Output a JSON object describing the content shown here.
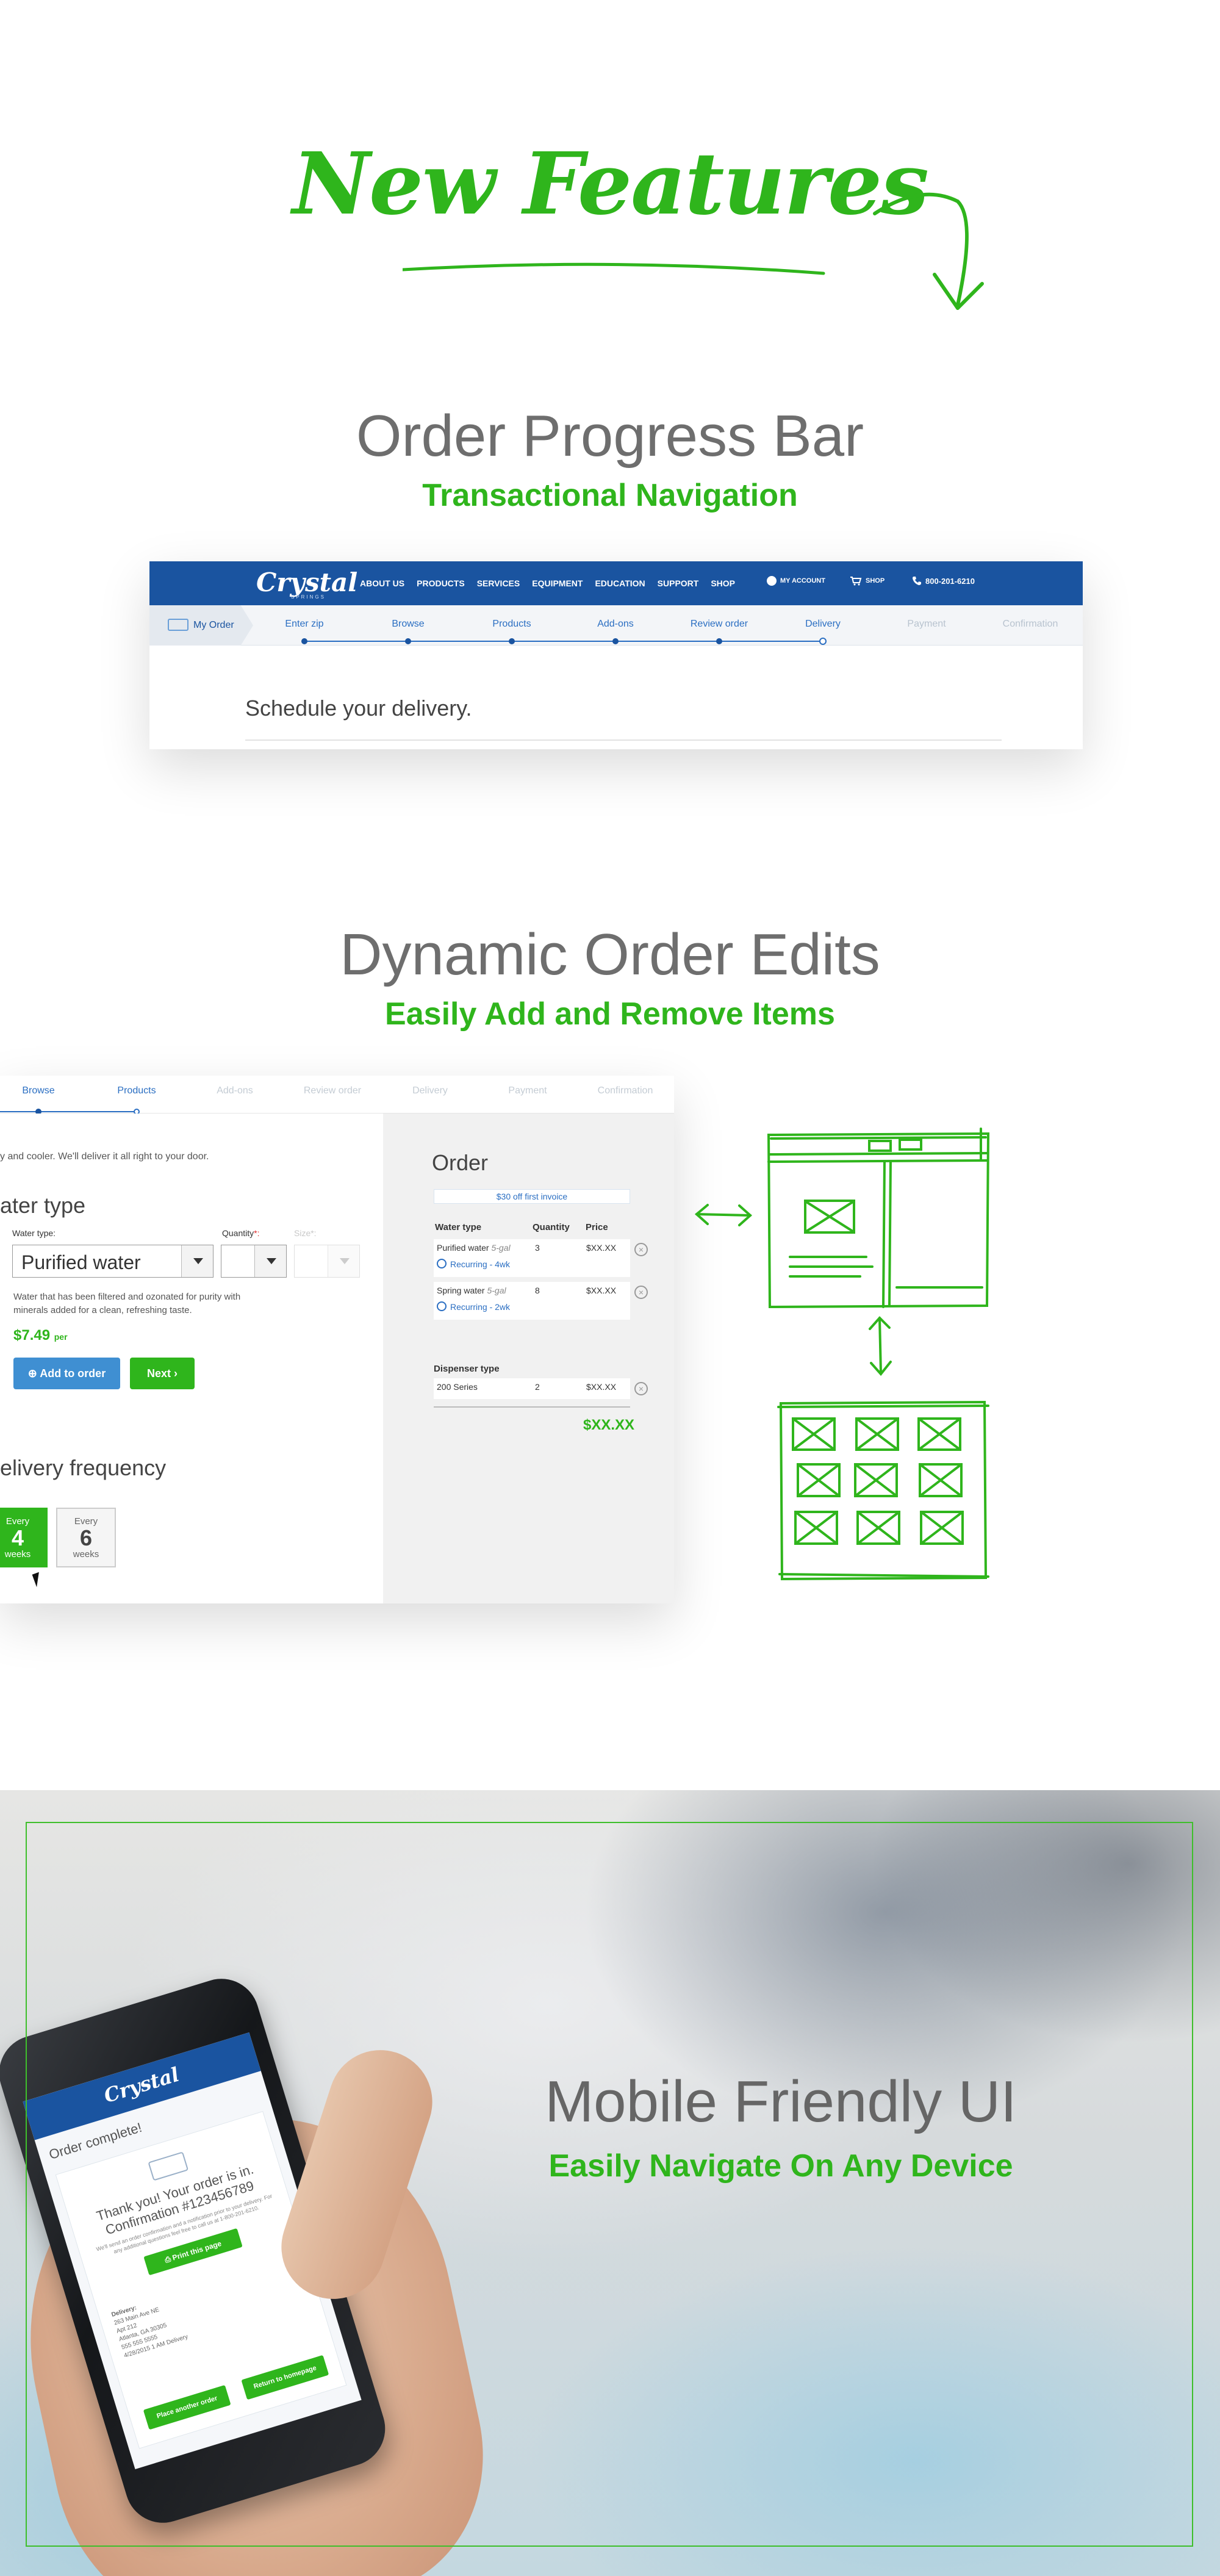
{
  "hero": {
    "title": "New Features"
  },
  "section1": {
    "title": "Order Progress Bar",
    "subtitle": "Transactional Navigation",
    "brand": {
      "logo": "Crystal",
      "tagline": "SPRINGS"
    },
    "nav": [
      "ABOUT US",
      "PRODUCTS",
      "SERVICES",
      "EQUIPMENT",
      "EDUCATION",
      "SUPPORT",
      "SHOP"
    ],
    "account": "MY ACCOUNT",
    "shop": "SHOP",
    "phone": "800-201-6210",
    "my_order": "My Order",
    "steps": [
      {
        "label": "Enter zip",
        "done": true
      },
      {
        "label": "Browse",
        "done": true
      },
      {
        "label": "Products",
        "done": true
      },
      {
        "label": "Add-ons",
        "done": true
      },
      {
        "label": "Review order",
        "done": true
      },
      {
        "label": "Delivery",
        "done": true,
        "current": true
      },
      {
        "label": "Payment",
        "done": false
      },
      {
        "label": "Confirmation",
        "done": false
      }
    ],
    "heading": "Schedule your delivery."
  },
  "section2": {
    "title": "Dynamic Order Edits",
    "subtitle": "Easily Add and Remove Items",
    "steps": [
      "Browse",
      "Products",
      "Add-ons",
      "Review order",
      "Delivery",
      "Payment",
      "Confirmation"
    ],
    "intro": "y and cooler. We'll deliver it all right to your door.",
    "type_heading": "ater type",
    "water_type_label": "Water type:",
    "quantity_label": "Quantity",
    "size_label": "Size*:",
    "water_type_value": "Purified water",
    "description": "Water that has been filtered and ozonated for purity with minerals added for a clean, refreshing taste.",
    "price": "$7.49",
    "price_unit": "per",
    "add_to_order": "Add to order",
    "next": "Next",
    "frequency_heading": "elivery frequency",
    "frequency": [
      {
        "top": "Every",
        "num": "4",
        "unit": "weeks",
        "selected": true
      },
      {
        "top": "Every",
        "num": "6",
        "unit": "weeks",
        "selected": false
      }
    ],
    "order": {
      "title": "Order",
      "promo": "$30 off first invoice",
      "headers": [
        "Water type",
        "Quantity",
        "Price"
      ],
      "items": [
        {
          "name": "Purified water",
          "size": "5-gal",
          "qty": "3",
          "price": "$XX.XX",
          "recurring": "Recurring - 4wk"
        },
        {
          "name": "Spring water",
          "size": "5-gal",
          "qty": "8",
          "price": "$XX.XX",
          "recurring": "Recurring - 2wk"
        }
      ],
      "dispenser_header": "Dispenser type",
      "dispenser": {
        "name": "200 Series",
        "qty": "2",
        "price": "$XX.XX"
      },
      "total": "$XX.XX"
    }
  },
  "section3": {
    "title": "Mobile Friendly UI",
    "subtitle": "Easily Navigate On Any Device",
    "phone": {
      "logo": "Crystal",
      "title": "Order complete!",
      "thanks": "Thank you! Your order is in. Confirmation #123456789",
      "note": "We'll send an order confirmation and a notification prior to your delivery. For any additional questions feel free to call us at 1-800-201-6210.",
      "print": "Print this page",
      "address_label": "Delivery:",
      "address": [
        "263 Main Ave NE",
        "Apt 212",
        "Atlanta, GA 30305",
        "555 555 5555",
        "4/28/2015 1 AM Delivery"
      ],
      "place_another": "Place another order",
      "return_home": "Return to homepage"
    }
  },
  "colors": {
    "green": "#2fb51c",
    "blue": "#1a54a0",
    "link": "#2a6ec2"
  }
}
